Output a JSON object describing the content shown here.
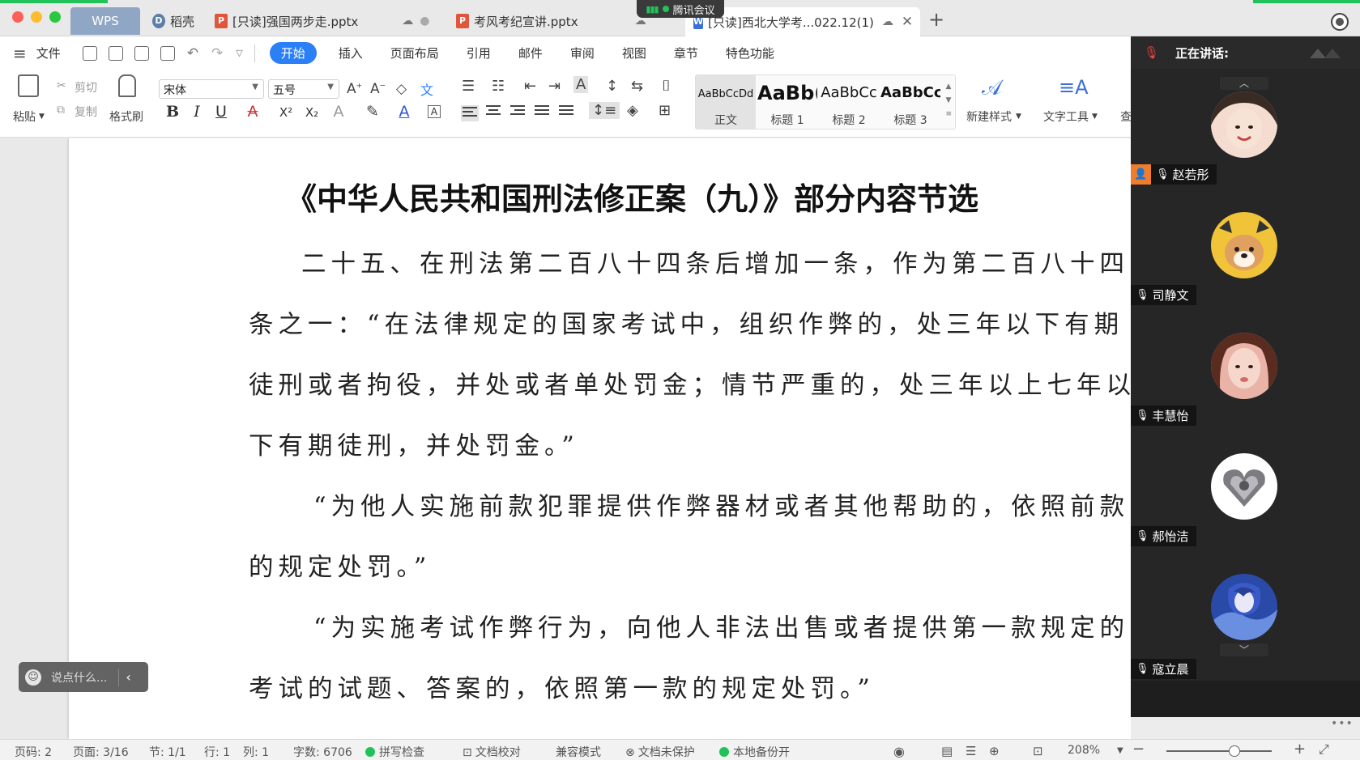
{
  "tabbar": {
    "wps_label": "WPS",
    "tabs": [
      {
        "label": "稻壳",
        "type": "daoke"
      },
      {
        "label": "[只读]强国两步走.pptx",
        "type": "pptx"
      },
      {
        "label": "考风考纪宣讲.pptx",
        "type": "pptx"
      },
      {
        "label": "[只读]西北大学考...022.12(1)",
        "type": "docx",
        "active": true
      }
    ],
    "meeting_badge": "腾讯会议",
    "add_tab": "+"
  },
  "menubar": {
    "file_label": "文件",
    "items": [
      "开始",
      "插入",
      "页面布局",
      "引用",
      "邮件",
      "审阅",
      "视图",
      "章节",
      "特色功能"
    ],
    "active_item": "开始"
  },
  "ribbon": {
    "paste": "粘贴",
    "cut": "剪切",
    "copy": "复制",
    "format_painter": "格式刷",
    "font_name": "宋体",
    "font_size": "五号",
    "styles": [
      {
        "sample": "AaBbCcDd",
        "name": "正文"
      },
      {
        "sample": "AaBb(",
        "name": "标题 1"
      },
      {
        "sample": "AaBbCc",
        "name": "标题 2"
      },
      {
        "sample": "AaBbCc",
        "name": "标题 3"
      }
    ],
    "new_style": "新建样式",
    "text_tools": "文字工具",
    "find": "查"
  },
  "document": {
    "title": "《中华人民共和国刑法修正案（九）》部分内容节选",
    "lines": [
      "二十五、在刑法第二百八十四条后增加一条，作为第二百八十四",
      "条之一：“在法律规定的国家考试中，组织作弊的，处三年以下有期",
      "徒刑或者拘役，并处或者单处罚金；情节严重的，处三年以上七年以",
      "下有期徒刑，并处罚金。”",
      "“为他人实施前款犯罪提供作弊器材或者其他帮助的，依照前款",
      "的规定处罚。”",
      "“为实施考试作弊行为，向他人非法出售或者提供第一款规定的",
      "考试的试题、答案的，依照第一款的规定处罚。”"
    ]
  },
  "chat": {
    "placeholder": "说点什么..."
  },
  "meeting": {
    "speaking_label": "正在讲话:",
    "participants": [
      {
        "name": "赵若彤",
        "host": true
      },
      {
        "name": "司静文",
        "host": false
      },
      {
        "name": "丰慧怡",
        "host": false
      },
      {
        "name": "郝怡洁",
        "host": false
      },
      {
        "name": "寇立晨",
        "host": false
      }
    ]
  },
  "statusbar": {
    "page_code": "页码: 2",
    "page": "页面: 3/16",
    "section": "节: 1/1",
    "row": "行: 1",
    "col": "列: 1",
    "word_count": "字数: 6706",
    "spell_check": "拼写检查",
    "doc_proof": "文档校对",
    "compat_mode": "兼容模式",
    "doc_unprotected": "文档未保护",
    "local_backup": "本地备份开",
    "zoom": "208%"
  },
  "colors": {
    "accent": "#2b80f8",
    "meeting_green": "#21c25a",
    "host_orange": "#f07d2c",
    "panel_bg": "#1e1e1e"
  }
}
